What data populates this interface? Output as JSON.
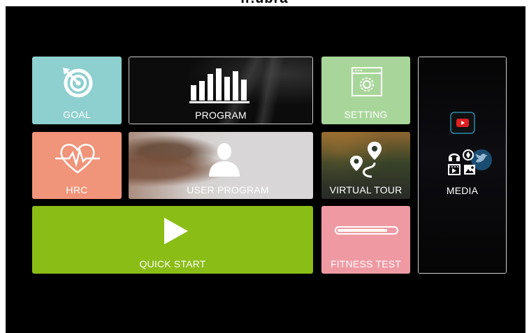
{
  "brand": {
    "text": "ir.ubra"
  },
  "tiles": {
    "goal": {
      "label": "GOAL",
      "icon": "target-icon",
      "color": "#8ecfcf"
    },
    "program": {
      "label": "PROGRAM",
      "icon": "bar-chart-icon"
    },
    "setting": {
      "label": "SETTING",
      "icon": "settings-window-icon",
      "color": "#a8d69a"
    },
    "media": {
      "label": "MEDIA",
      "icons": [
        "youtube-icon",
        "headphones-icon",
        "camera-icon",
        "twitter-icon",
        "video-icon",
        "photo-icon"
      ]
    },
    "hrc": {
      "label": "HRC",
      "icon": "heart-rate-icon",
      "color": "#f0947a"
    },
    "user_program": {
      "label": "USER PROGRAM",
      "icon": "user-silhouette-icon"
    },
    "virtual_tour": {
      "label": "VIRTUAL TOUR",
      "icon": "route-pin-icon"
    },
    "quick_start": {
      "label": "QUICK START",
      "icon": "play-icon",
      "color": "#8bbd17"
    },
    "fitness_test": {
      "label": "FITNESS TEST",
      "icon": "progress-bar-icon",
      "progress": 0.82,
      "color": "#ef9aa3"
    }
  }
}
